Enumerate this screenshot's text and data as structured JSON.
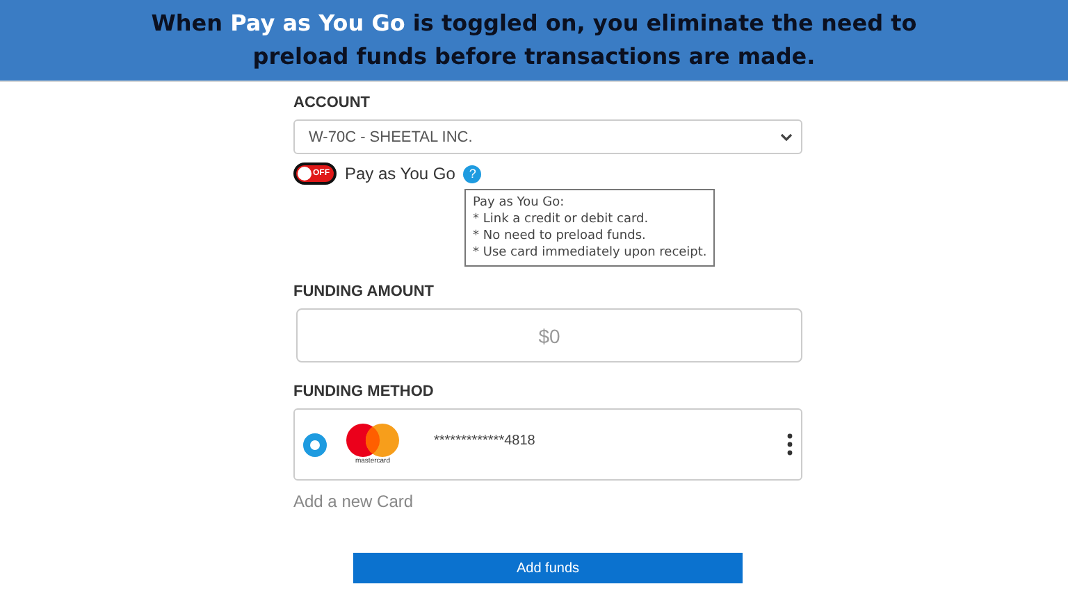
{
  "banner": {
    "text": "When **Pay as You Go** is toggled on, you eliminate the need to preload funds before transactions are made."
  },
  "account": {
    "label": "ACCOUNT",
    "value": "W-70C - SHEETAL INC."
  },
  "pay_as_you_go": {
    "on": false,
    "switch_text": "OFF",
    "label": "Pay as You Go",
    "help_icon": "?"
  },
  "tooltip": {
    "lines": [
      "Pay as You Go:",
      "* Link a credit or debit card.",
      "* No need to preload funds.",
      "* Use card immediately upon receipt."
    ]
  },
  "funding_amount": {
    "label": "FUNDING AMOUNT",
    "placeholder": "$0"
  },
  "funding_method": {
    "label": "FUNDING METHOD",
    "cards": [
      {
        "selected": true,
        "brand_label": "mastercard",
        "number": "*************4818"
      }
    ],
    "add_card": "Add a new Card"
  },
  "submit": "Add funds"
}
